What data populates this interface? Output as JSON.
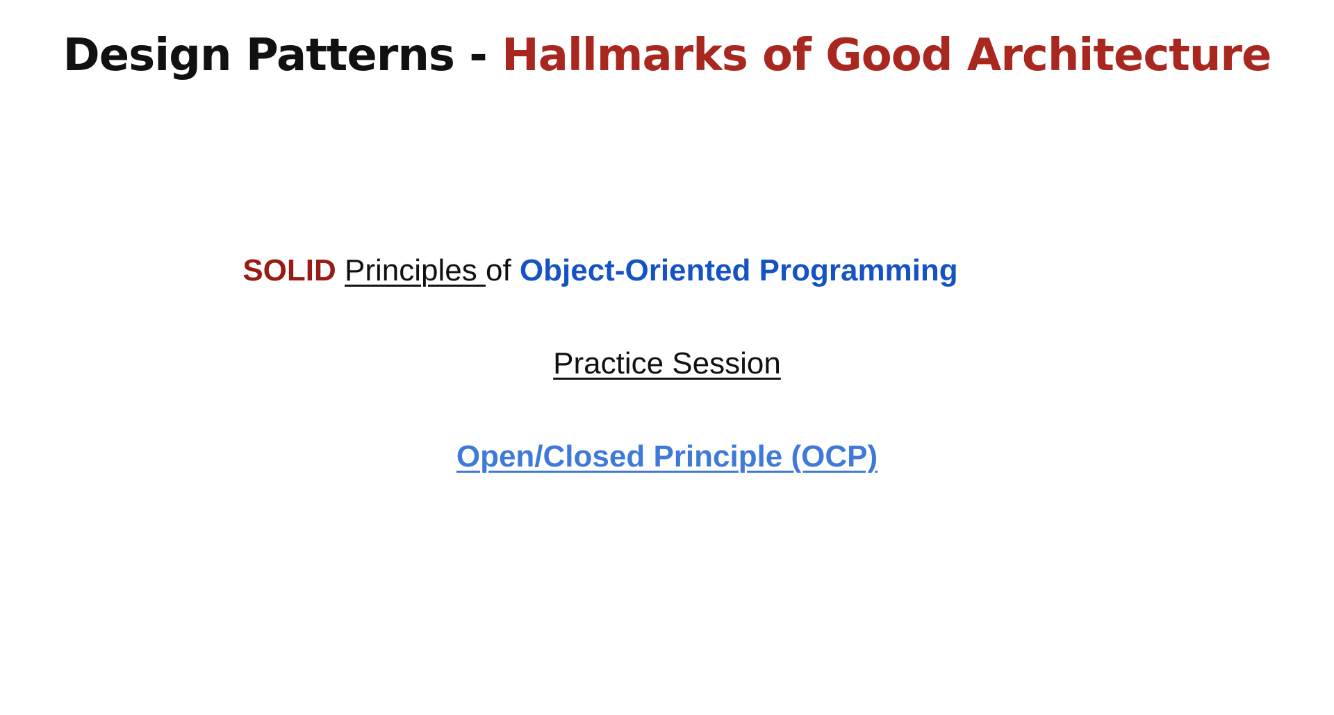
{
  "title": {
    "prefix": "Design Patterns - ",
    "main": "Hallmarks of Good Architecture"
  },
  "line1": {
    "solid": "SOLID",
    "principles": "Principles ",
    "of": "of ",
    "oop": "Object-Oriented Programming"
  },
  "line2": {
    "text": "Practice Session"
  },
  "line3": {
    "link": "Open/Closed Principle (OCP)"
  },
  "colors": {
    "title_prefix": "#111111",
    "title_main": "#a8281f",
    "solid": "#981b16",
    "oop": "#1552c4",
    "link": "#3f7ad8"
  }
}
